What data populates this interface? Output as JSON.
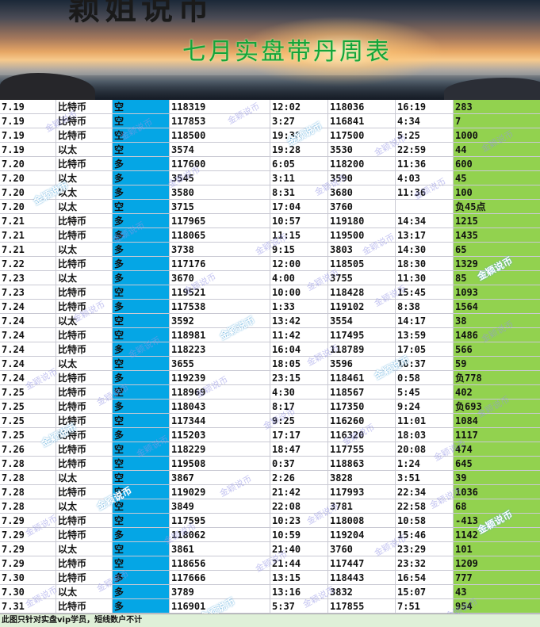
{
  "header": {
    "brand": "颖姐说币",
    "subtitle": "七月实盘带丹周表"
  },
  "colors": {
    "direction_column": "#05a6e5",
    "result_column": "#92d24f",
    "subtitle": "#16a43a"
  },
  "rows": [
    [
      "7.19",
      "比特币",
      "空",
      "118319",
      "12:02",
      "118036",
      "16:19",
      "283"
    ],
    [
      "7.19",
      "比特币",
      "空",
      "117853",
      "3:27",
      "116841",
      "4:34",
      "7"
    ],
    [
      "7.19",
      "比特币",
      "空",
      "118500",
      "19:30",
      "117500",
      "5:25",
      "1000"
    ],
    [
      "7.19",
      "以太",
      "空",
      "3574",
      "19:28",
      "3530",
      "22:59",
      "44"
    ],
    [
      "7.20",
      "比特币",
      "多",
      "117600",
      "6:05",
      "118200",
      "11:36",
      "600"
    ],
    [
      "7.20",
      "以太",
      "多",
      "3545",
      "3:11",
      "3590",
      "4:03",
      "45"
    ],
    [
      "7.20",
      "以太",
      "多",
      "3580",
      "8:31",
      "3680",
      "11:36",
      "100"
    ],
    [
      "7.20",
      "以太",
      "空",
      "3715",
      "17:04",
      "3760",
      "",
      "负45点"
    ],
    [
      "7.21",
      "比特币",
      "多",
      "117965",
      "10:57",
      "119180",
      "14:34",
      "1215"
    ],
    [
      "7.21",
      "比特币",
      "多",
      "118065",
      "11:15",
      "119500",
      "13:17",
      "1435"
    ],
    [
      "7.21",
      "以太",
      "多",
      "3738",
      "9:15",
      "3803",
      "14:30",
      "65"
    ],
    [
      "7.22",
      "比特币",
      "多",
      "117176",
      "12:00",
      "118505",
      "18:30",
      "1329"
    ],
    [
      "7.23",
      "以太",
      "多",
      "3670",
      "4:00",
      "3755",
      "11:30",
      "85"
    ],
    [
      "7.23",
      "比特币",
      "空",
      "119521",
      "10:00",
      "118428",
      "15:45",
      "1093"
    ],
    [
      "7.24",
      "比特币",
      "多",
      "117538",
      "1:33",
      "119102",
      "8:38",
      "1564"
    ],
    [
      "7.24",
      "以太",
      "空",
      "3592",
      "13:42",
      "3554",
      "14:17",
      "38"
    ],
    [
      "7.24",
      "比特币",
      "空",
      "118981",
      "11:42",
      "117495",
      "13:59",
      "1486"
    ],
    [
      "7.24",
      "比特币",
      "多",
      "118223",
      "16:04",
      "118789",
      "17:05",
      "566"
    ],
    [
      "7.24",
      "以太",
      "空",
      "3655",
      "18:05",
      "3596",
      "18:37",
      "59"
    ],
    [
      "7.24",
      "比特币",
      "多",
      "119239",
      "23:15",
      "118461",
      "0:58",
      "负778"
    ],
    [
      "7.25",
      "比特币",
      "空",
      "118969",
      "4:30",
      "118567",
      "5:45",
      "402"
    ],
    [
      "7.25",
      "比特币",
      "多",
      "118043",
      "8:17",
      "117350",
      "9:24",
      "负693"
    ],
    [
      "7.25",
      "比特币",
      "空",
      "117344",
      "9:25",
      "116260",
      "11:01",
      "1084"
    ],
    [
      "7.25",
      "比特币",
      "多",
      "115203",
      "17:17",
      "116320",
      "18:03",
      "1117"
    ],
    [
      "7.26",
      "比特币",
      "空",
      "118229",
      "18:47",
      "117755",
      "20:08",
      "474"
    ],
    [
      "7.28",
      "比特币",
      "空",
      "119508",
      "0:37",
      "118863",
      "1:24",
      "645"
    ],
    [
      "7.28",
      "以太",
      "空",
      "3867",
      "2:26",
      "3828",
      "3:51",
      "39"
    ],
    [
      "7.28",
      "比特币",
      "空",
      "119029",
      "21:42",
      "117993",
      "22:34",
      "1036"
    ],
    [
      "7.28",
      "以太",
      "空",
      "3849",
      "22:08",
      "3781",
      "22:58",
      "68"
    ],
    [
      "7.29",
      "比特币",
      "空",
      "117595",
      "10:23",
      "118008",
      "10:58",
      "-413"
    ],
    [
      "7.29",
      "比特币",
      "多",
      "118062",
      "10:59",
      "119204",
      "15:46",
      "1142"
    ],
    [
      "7.29",
      "以太",
      "空",
      "3861",
      "21:40",
      "3760",
      "23:29",
      "101"
    ],
    [
      "7.29",
      "比特币",
      "空",
      "118656",
      "21:44",
      "117447",
      "23:32",
      "1209"
    ],
    [
      "7.30",
      "比特币",
      "多",
      "117666",
      "13:15",
      "118443",
      "16:54",
      "777"
    ],
    [
      "7.30",
      "以太",
      "多",
      "3789",
      "13:16",
      "3832",
      "15:07",
      "43"
    ],
    [
      "7.31",
      "比特币",
      "多",
      "116901",
      "5:37",
      "117855",
      "7:51",
      "954"
    ]
  ],
  "watermark": {
    "text": "金颖说币",
    "small": "vx: yingjie"
  },
  "footer": "此图只针对实盘vip学员，短线数户不计"
}
